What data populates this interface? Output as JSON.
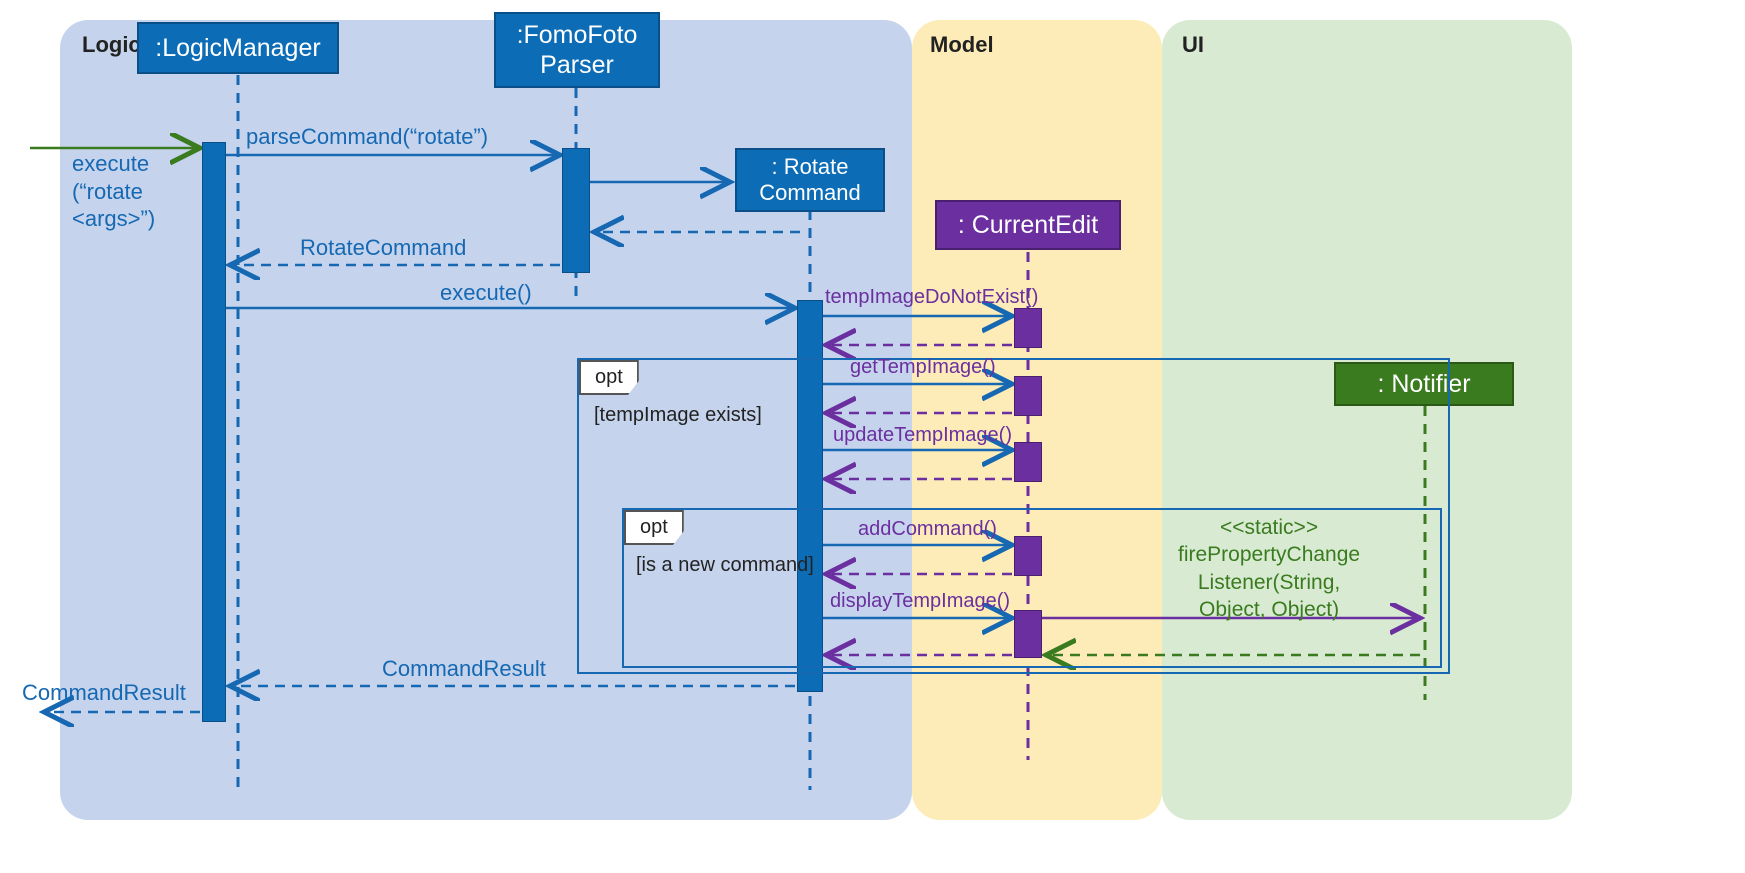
{
  "regions": {
    "logic": "Logic",
    "model": "Model",
    "ui": "UI"
  },
  "lifelines": {
    "logicManager": ":LogicManager",
    "fomoFotoParser": ":FomoFoto\nParser",
    "rotateCommand": ": Rotate\nCommand",
    "currentEdit": ": CurrentEdit",
    "notifier": ": Notifier"
  },
  "messages": {
    "executeIn": "execute\n(“rotate\n<args>”)",
    "parseCommand": "parseCommand(“rotate”)",
    "rotateCommandReturn": "RotateCommand",
    "execute": "execute()",
    "tempImageDoNotExist": "tempImageDoNotExist()",
    "getTempImage": "getTempImage()",
    "updateTempImage": "updateTempImage()",
    "addCommand": "addCommand()",
    "displayTempImage": "displayTempImage()",
    "firePropertyChange": "<<static>>\nfirePropertyChange\nListener(String,\nObject, Object)",
    "commandResult": "CommandResult",
    "commandResultOut": "CommandResult"
  },
  "frames": {
    "opt1": {
      "tag": "opt",
      "guard": "[tempImage exists]"
    },
    "opt2": {
      "tag": "opt",
      "guard": "[is a new command]"
    }
  }
}
